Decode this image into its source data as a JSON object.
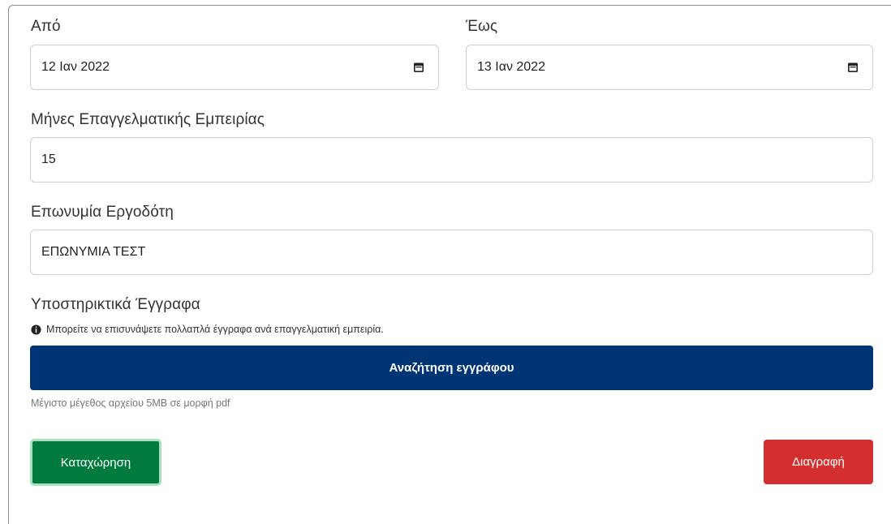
{
  "from": {
    "label": "Από",
    "value": "12 Ιαν 2022",
    "icon": "calendar-icon"
  },
  "to": {
    "label": "Έως",
    "value": "13 Ιαν 2022",
    "icon": "calendar-icon"
  },
  "months": {
    "label": "Μήνες Επαγγελματικής Εμπειρίας",
    "value": "15"
  },
  "employer": {
    "label": "Επωνυμία Εργοδότη",
    "value": "ΕΠΩΝΥΜΙΑ ΤΕΣΤ"
  },
  "documents": {
    "label": "Υποστηρικτικά Έγγραφα",
    "info_icon": "info-circle-icon",
    "info_text": "Μπορείτε να επισυνάψετε πολλαπλά έγγραφα ανά επαγγελματική εμπειρία.",
    "browse_label": "Αναζήτηση εγγράφου",
    "hint": "Μέγιστο μέγεθος αρχείου 5MB σε μορφή pdf"
  },
  "actions": {
    "save_label": "Καταχώρηση",
    "delete_label": "Διαγραφή"
  },
  "colors": {
    "browse_button": "#003575",
    "save_button": "#007a3d",
    "delete_button": "#d32f2f"
  }
}
